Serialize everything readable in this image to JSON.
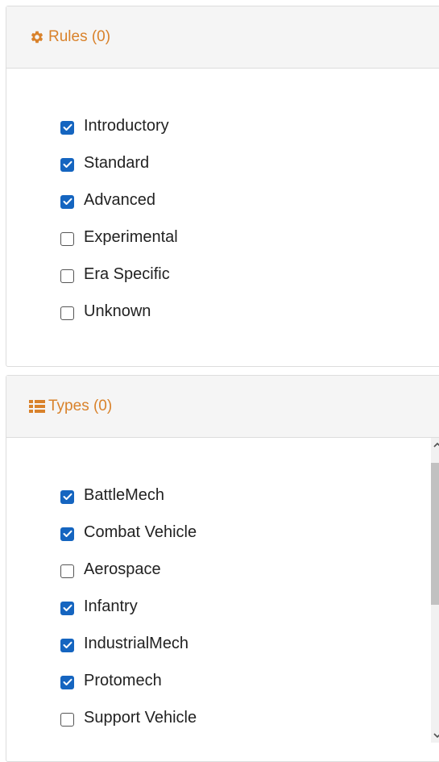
{
  "rules_panel": {
    "title": "Rules (0)",
    "icon": "gear-icon",
    "items": [
      {
        "label": "Introductory",
        "checked": true
      },
      {
        "label": "Standard",
        "checked": true
      },
      {
        "label": "Advanced",
        "checked": true
      },
      {
        "label": "Experimental",
        "checked": false
      },
      {
        "label": "Era Specific",
        "checked": false
      },
      {
        "label": "Unknown",
        "checked": false
      }
    ]
  },
  "types_panel": {
    "title": "Types (0)",
    "icon": "list-icon",
    "items": [
      {
        "label": "BattleMech",
        "checked": true
      },
      {
        "label": "Combat Vehicle",
        "checked": true
      },
      {
        "label": "Aerospace",
        "checked": false
      },
      {
        "label": "Infantry",
        "checked": true
      },
      {
        "label": "IndustrialMech",
        "checked": true
      },
      {
        "label": "Protomech",
        "checked": true
      },
      {
        "label": "Support Vehicle",
        "checked": false
      }
    ]
  },
  "colors": {
    "accent": "#d9822b",
    "checkbox": "#1565c0"
  }
}
